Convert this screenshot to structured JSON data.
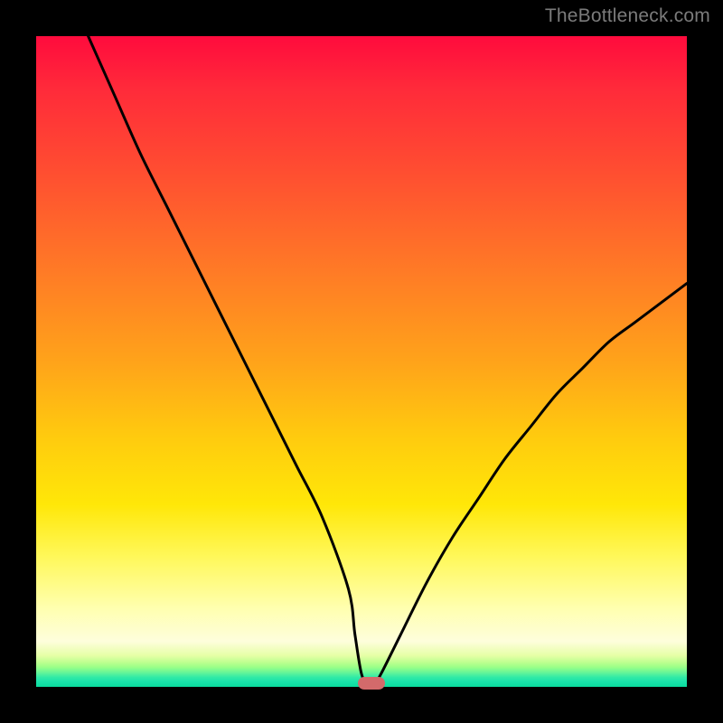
{
  "watermark": "TheBottleneck.com",
  "chart_data": {
    "type": "line",
    "title": "",
    "xlabel": "",
    "ylabel": "",
    "xlim": [
      0,
      100
    ],
    "ylim": [
      0,
      100
    ],
    "grid": false,
    "legend": false,
    "series": [
      {
        "name": "bottleneck-curve",
        "x": [
          8,
          12,
          16,
          20,
          24,
          28,
          32,
          36,
          40,
          44,
          48,
          49,
          50,
          51,
          52,
          53,
          56,
          60,
          64,
          68,
          72,
          76,
          80,
          84,
          88,
          92,
          96,
          100
        ],
        "values": [
          100,
          91,
          82,
          74,
          66,
          58,
          50,
          42,
          34,
          26,
          15,
          8,
          2,
          0.5,
          0.5,
          2,
          8,
          16,
          23,
          29,
          35,
          40,
          45,
          49,
          53,
          56,
          59,
          62
        ]
      }
    ],
    "annotations": [
      {
        "name": "min-marker",
        "x": 51.5,
        "y": 0.5,
        "shape": "pill",
        "color": "#d36a6b"
      }
    ],
    "background_gradient": {
      "direction": "vertical",
      "stops": [
        {
          "pos": 0,
          "color": "#ff0b3d"
        },
        {
          "pos": 50,
          "color": "#ffa31a"
        },
        {
          "pos": 80,
          "color": "#fff85a"
        },
        {
          "pos": 100,
          "color": "#0adc9e"
        }
      ]
    }
  }
}
